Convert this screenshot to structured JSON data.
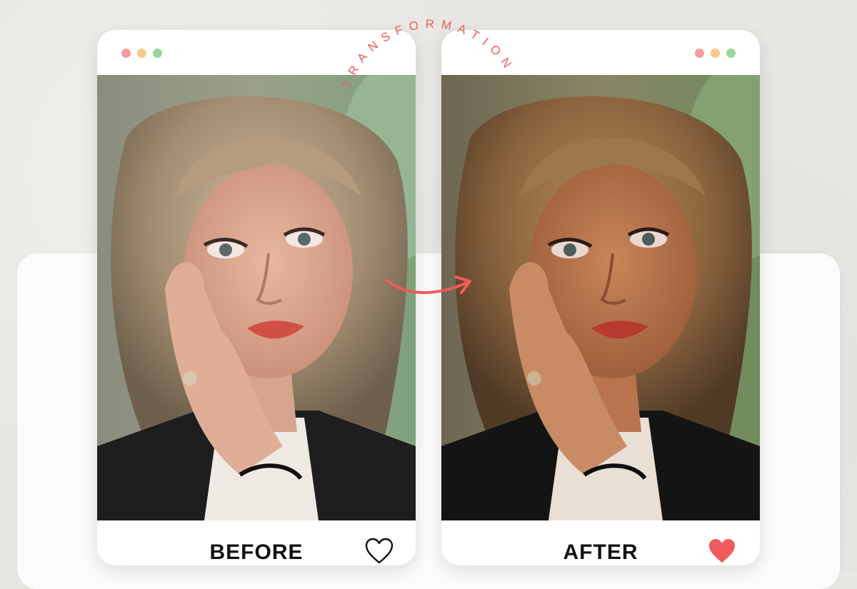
{
  "colors": {
    "accent": "#f15b5b",
    "dot_red": "#f59c9c",
    "dot_yellow": "#f7c98a",
    "dot_green": "#9ad69b",
    "label_text": "#111111"
  },
  "header": {
    "arc_text": "TRANSFORMATION"
  },
  "cards": {
    "before": {
      "label": "BEFORE",
      "heart_state": "outline",
      "heart_icon": "heart-outline-icon"
    },
    "after": {
      "label": "AFTER",
      "heart_state": "filled",
      "heart_icon": "heart-filled-icon"
    }
  },
  "arrow_icon": "curved-arrow-right-icon"
}
